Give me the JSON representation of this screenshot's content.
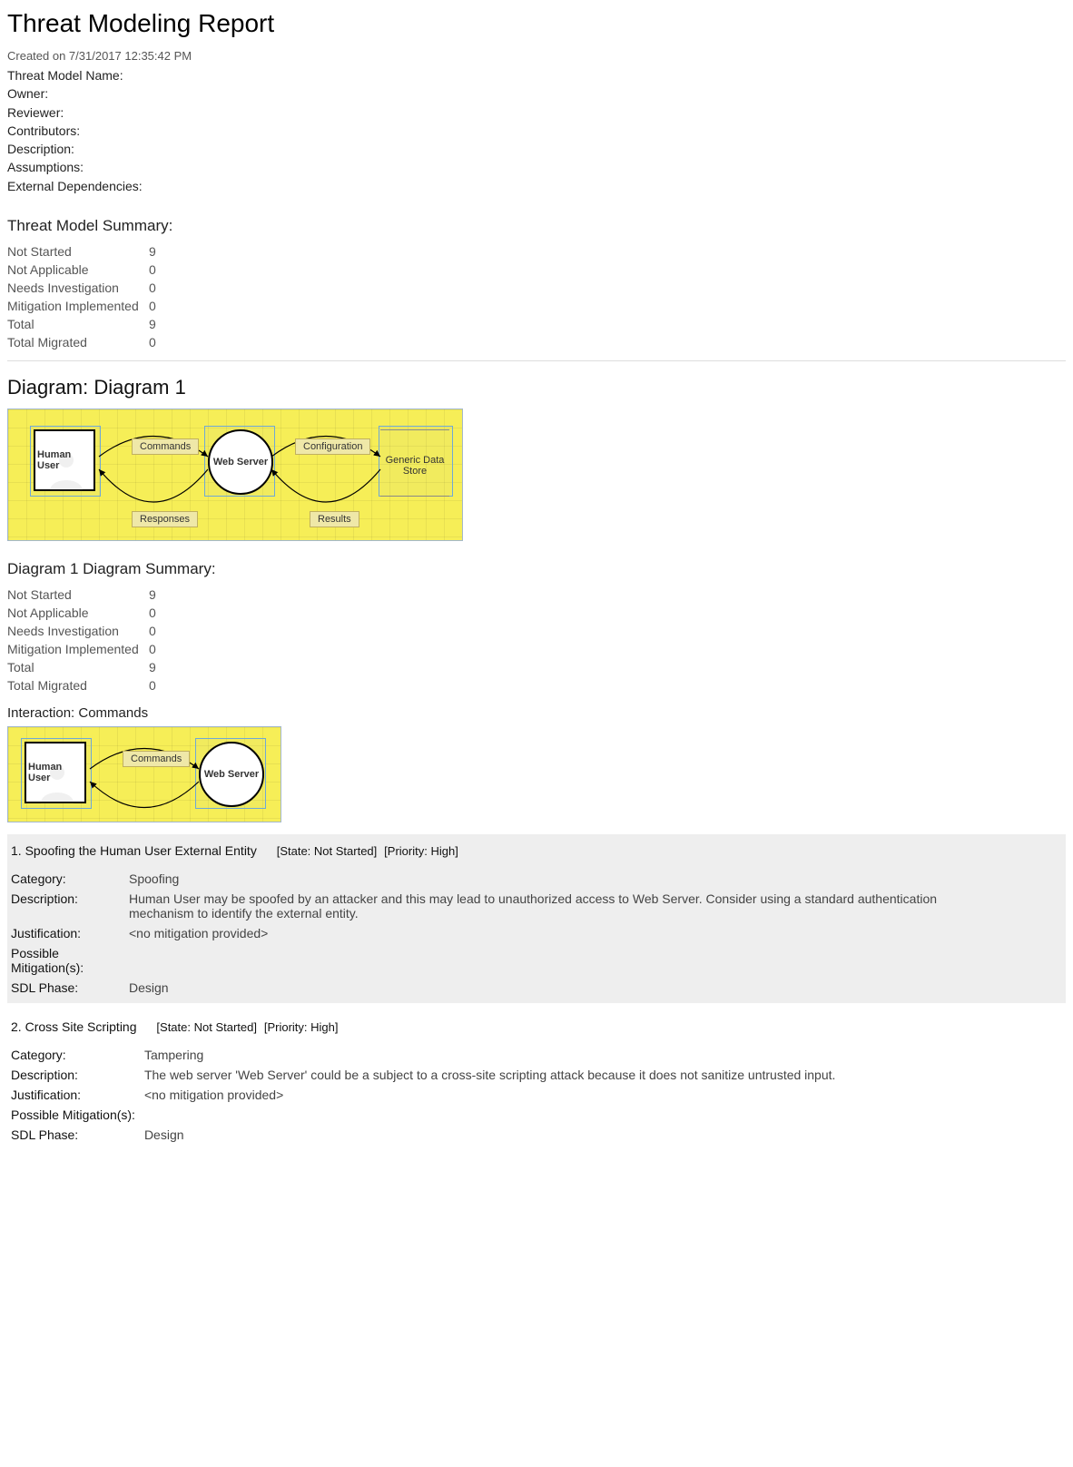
{
  "title": "Threat Modeling Report",
  "created_on": "Created on 7/31/2017 12:35:42 PM",
  "meta": {
    "threat_model_name": {
      "label": "Threat Model Name:",
      "value": ""
    },
    "owner": {
      "label": "Owner:",
      "value": ""
    },
    "reviewer": {
      "label": "Reviewer:",
      "value": ""
    },
    "contributors": {
      "label": "Contributors:",
      "value": ""
    },
    "description": {
      "label": "Description:",
      "value": ""
    },
    "assumptions": {
      "label": "Assumptions:",
      "value": ""
    },
    "external_deps": {
      "label": "External Dependencies:",
      "value": ""
    }
  },
  "model_summary": {
    "heading": "Threat Model Summary:",
    "rows": [
      {
        "label": "Not Started",
        "value": "9"
      },
      {
        "label": "Not Applicable",
        "value": "0"
      },
      {
        "label": "Needs Investigation",
        "value": "0"
      },
      {
        "label": "Mitigation Implemented",
        "value": "0"
      },
      {
        "label": "Total",
        "value": "9"
      },
      {
        "label": "Total Migrated",
        "value": "0"
      }
    ]
  },
  "diagram": {
    "title": "Diagram: Diagram 1",
    "nodes": {
      "human_user": "Human User",
      "web_server": "Web Server",
      "generic_store": "Generic Data Store"
    },
    "flows": {
      "commands": "Commands",
      "responses": "Responses",
      "configuration": "Configuration",
      "results": "Results"
    }
  },
  "diagram_summary": {
    "heading": "Diagram 1 Diagram Summary:",
    "rows": [
      {
        "label": "Not Started",
        "value": "9"
      },
      {
        "label": "Not Applicable",
        "value": "0"
      },
      {
        "label": "Needs Investigation",
        "value": "0"
      },
      {
        "label": "Mitigation Implemented",
        "value": "0"
      },
      {
        "label": "Total",
        "value": "9"
      },
      {
        "label": "Total Migrated",
        "value": "0"
      }
    ]
  },
  "interaction": {
    "heading": "Interaction: Commands"
  },
  "threats": [
    {
      "num": "1.",
      "name": "Spoofing the Human User External Entity",
      "state": "[State: Not Started]",
      "priority": "[Priority: High]",
      "category_label": "Category:",
      "category": "Spoofing",
      "description_label": "Description:",
      "description": "Human User may be spoofed by an attacker and this may lead to unauthorized access to Web Server. Consider using a standard authentication mechanism to identify the external entity.",
      "justification_label": "Justification:",
      "justification": "<no mitigation provided>",
      "mitigations_label": "Possible Mitigation(s):",
      "mitigations": "",
      "sdl_label": "SDL Phase:",
      "sdl": "Design"
    },
    {
      "num": "2.",
      "name": "Cross Site Scripting",
      "state": "[State: Not Started]",
      "priority": "[Priority: High]",
      "category_label": "Category:",
      "category": "Tampering",
      "description_label": "Description:",
      "description": "The web server 'Web Server' could be a subject to a cross-site scripting attack because it does not sanitize untrusted input.",
      "justification_label": "Justification:",
      "justification": "<no mitigation provided>",
      "mitigations_label": "Possible Mitigation(s):",
      "mitigations": "",
      "sdl_label": "SDL Phase:",
      "sdl": "Design"
    }
  ]
}
